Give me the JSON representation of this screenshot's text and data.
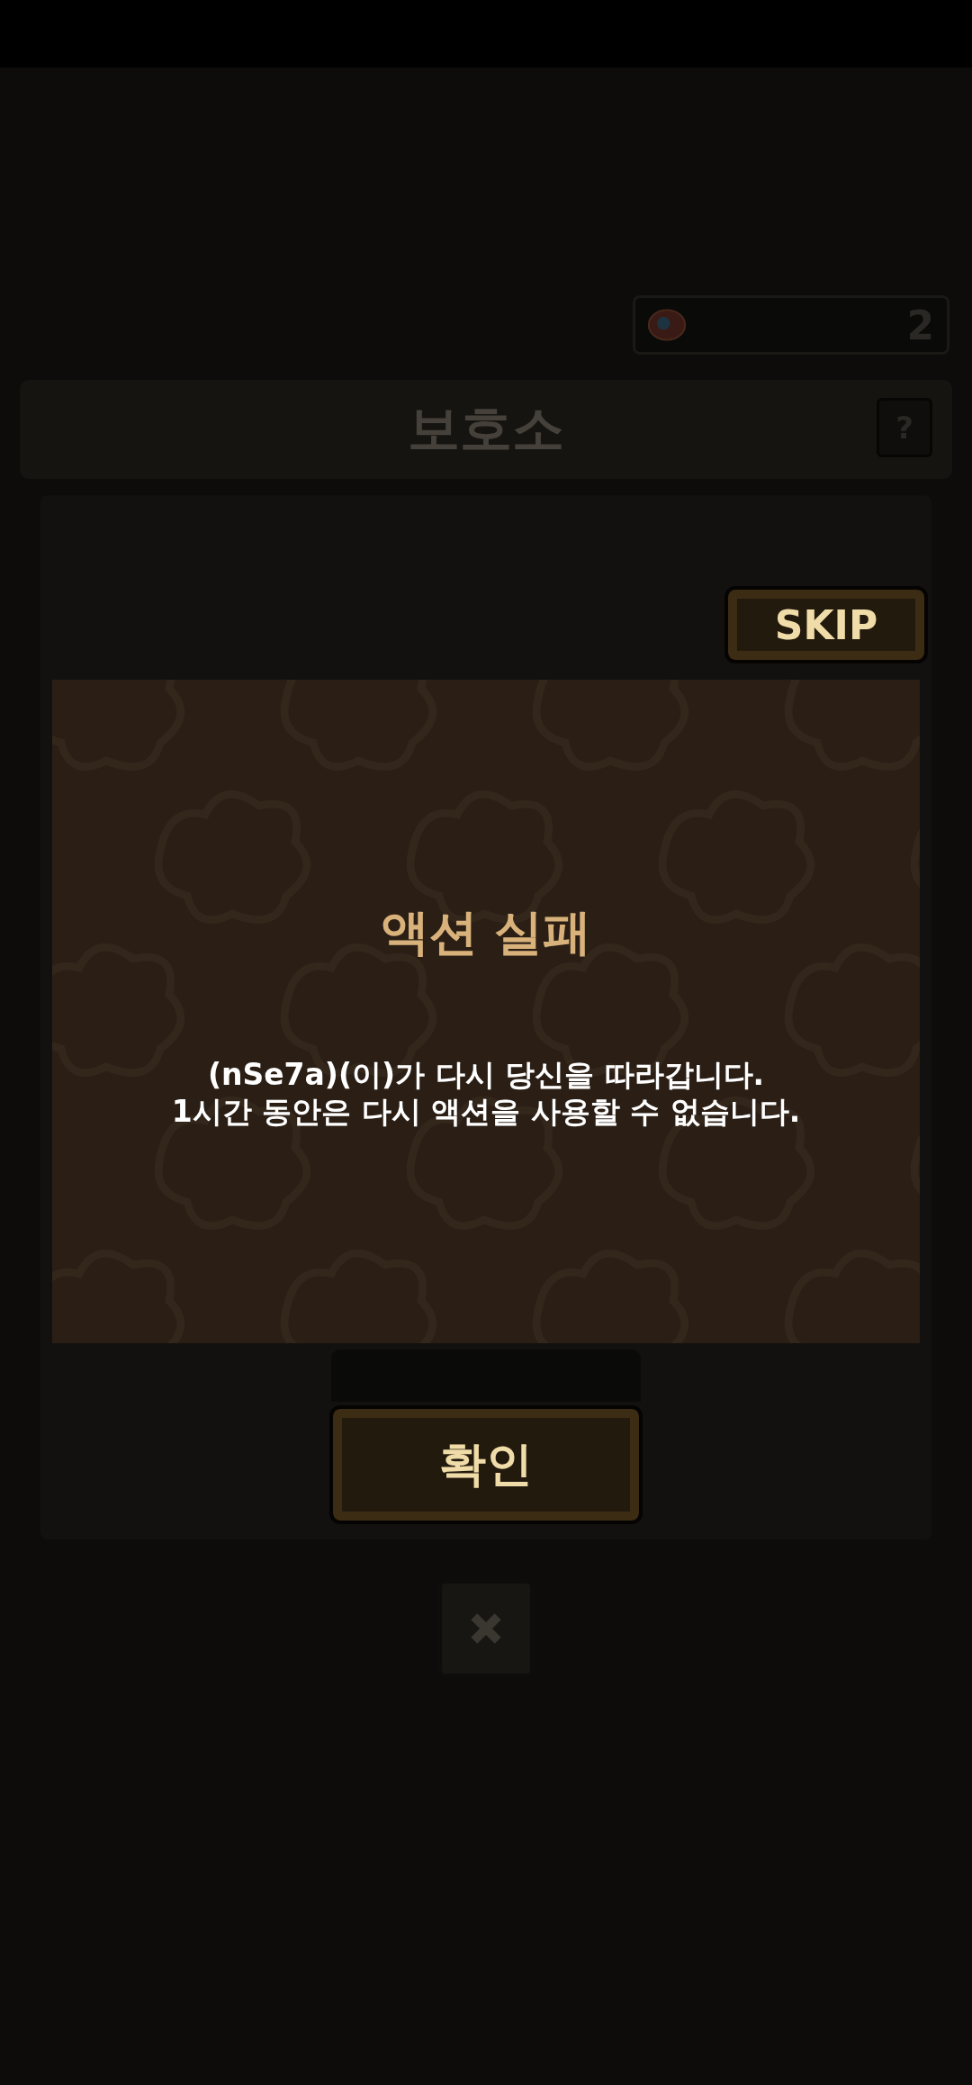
{
  "counter": {
    "value": "2"
  },
  "header": {
    "title": "보호소",
    "help_button": "?"
  },
  "skip_button": "SKIP",
  "dialog": {
    "title": "액션 실패",
    "message": "(nSe7a)(이)가 다시 당신을 따라갑니다.\n1시간 동안은 다시 액션을 사용할 수 없습니다.",
    "confirm_button": "확인"
  }
}
